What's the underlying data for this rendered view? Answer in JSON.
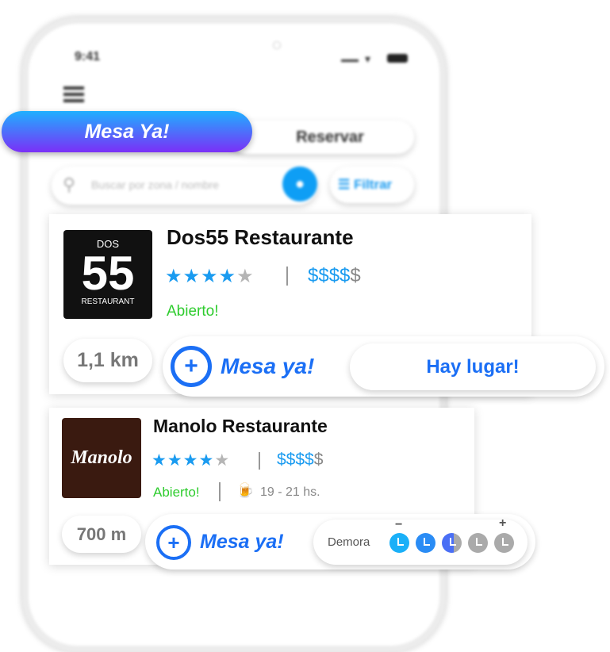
{
  "status_bar": {
    "time": "9:41"
  },
  "tabs": {
    "active": "Mesa Ya!",
    "other": "Reservar"
  },
  "search": {
    "placeholder": "Buscar por zona / nombre",
    "filter_label": "Filtrar"
  },
  "colors": {
    "accent": "#1a9bf0",
    "gradient_top": "#1fb0ff",
    "gradient_bottom": "#7b2ff7",
    "open_green": "#2ecc2e",
    "mesa_ya_blue": "#1b6ff5"
  },
  "restaurants": [
    {
      "name": "Dos55 Restaurante",
      "logo_text": "DOS 55 RESTAURANT",
      "rating": 4,
      "max_rating": 5,
      "price_level": 4,
      "price_max": 5,
      "price_symbols": "$$$$",
      "price_rest": "$",
      "status": "Abierto!",
      "distance": "1,1 km",
      "mesa_ya": "Mesa ya!",
      "availability": "Hay lugar!"
    },
    {
      "name": "Manolo Restaurante",
      "logo_text": "Manolo",
      "rating": 4,
      "max_rating": 5,
      "price_level": 4,
      "price_max": 5,
      "price_symbols": "$$$$",
      "price_rest": "$",
      "status": "Abierto!",
      "hours": "19 - 21 hs.",
      "distance": "700 m",
      "mesa_ya": "Mesa ya!",
      "delay_label": "Demora",
      "delay_minus": "−",
      "delay_plus": "+",
      "delay_level": 3,
      "delay_max": 5
    }
  ]
}
